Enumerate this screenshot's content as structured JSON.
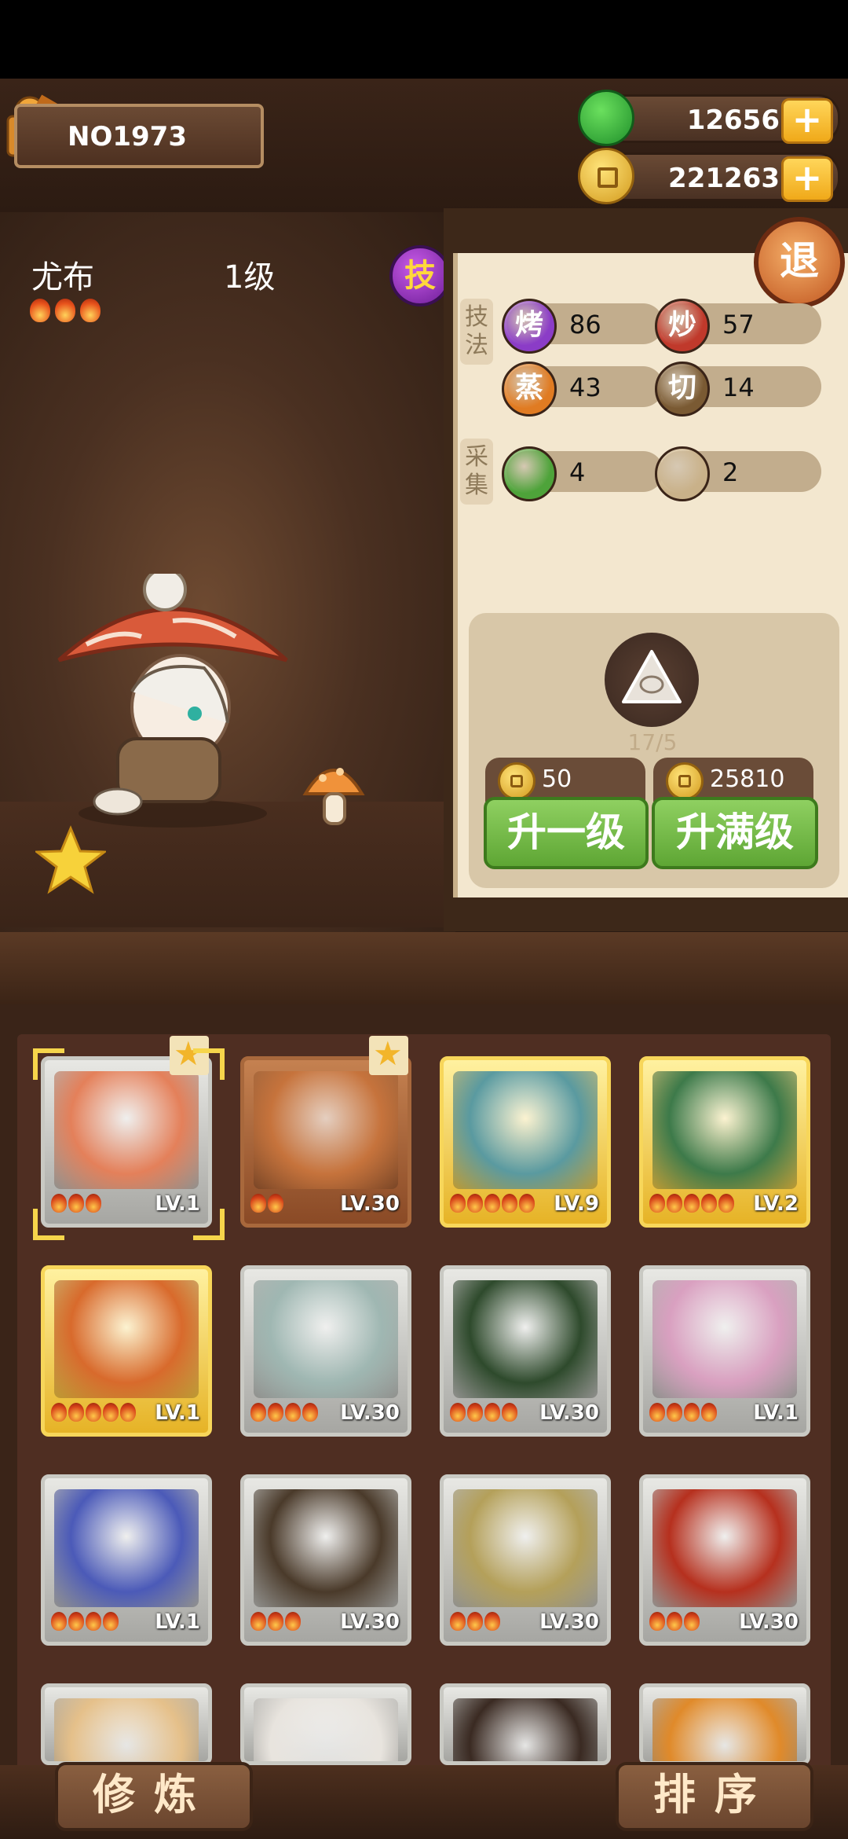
{
  "player": {
    "id": "NO1973"
  },
  "currency": {
    "jade": "12656",
    "coins": "221263"
  },
  "hero": {
    "name": "尤布",
    "level": "1级",
    "skill_badge": "技",
    "flames": 3
  },
  "panel": {
    "exit_label": "退",
    "technique_label": "技法",
    "gather_label": "采集",
    "stats": [
      {
        "icon": "烤",
        "value": "86",
        "color": "#8b3cc7"
      },
      {
        "icon": "炒",
        "value": "57",
        "color": "#c0392b"
      },
      {
        "icon": "蒸",
        "value": "43",
        "color": "#e07b22"
      },
      {
        "icon": "切",
        "value": "14",
        "color": "#7a5a33"
      },
      {
        "icon": "cabbage-icon",
        "value": "4",
        "color": "#4ea33a"
      },
      {
        "icon": "bun-icon",
        "value": "2",
        "color": "#c9b189"
      }
    ],
    "material_count": "17/5",
    "upgrade_one": {
      "cost": "50",
      "label": "升一级"
    },
    "upgrade_max": {
      "cost": "25810",
      "label": "升满级"
    }
  },
  "roster": [
    {
      "level": "LV.1",
      "flames": 3,
      "frame": "silver",
      "favorite": true,
      "selected": true,
      "color": "#e4805a"
    },
    {
      "level": "LV.30",
      "flames": 2,
      "frame": "brown",
      "favorite": true,
      "selected": false,
      "color": "#c6733c"
    },
    {
      "level": "LV.9",
      "flames": 5,
      "frame": "gold",
      "favorite": false,
      "selected": false,
      "color": "#5a9aa0"
    },
    {
      "level": "LV.2",
      "flames": 5,
      "frame": "gold",
      "favorite": false,
      "selected": false,
      "color": "#3d7a4a"
    },
    {
      "level": "LV.1",
      "flames": 5,
      "frame": "gold",
      "favorite": false,
      "selected": false,
      "color": "#d86a2c"
    },
    {
      "level": "LV.30",
      "flames": 4,
      "frame": "silver",
      "favorite": false,
      "selected": false,
      "color": "#9fb7b2"
    },
    {
      "level": "LV.30",
      "flames": 4,
      "frame": "silver",
      "favorite": false,
      "selected": false,
      "color": "#2e4a2c"
    },
    {
      "level": "LV.1",
      "flames": 4,
      "frame": "silver",
      "favorite": false,
      "selected": false,
      "color": "#d9a0c0"
    },
    {
      "level": "LV.1",
      "flames": 4,
      "frame": "silver",
      "favorite": false,
      "selected": false,
      "color": "#4b5ab8"
    },
    {
      "level": "LV.30",
      "flames": 3,
      "frame": "silver",
      "favorite": false,
      "selected": false,
      "color": "#4a3a2a"
    },
    {
      "level": "LV.30",
      "flames": 3,
      "frame": "silver",
      "favorite": false,
      "selected": false,
      "color": "#b4a05a"
    },
    {
      "level": "LV.30",
      "flames": 3,
      "frame": "silver",
      "favorite": false,
      "selected": false,
      "color": "#b6301e"
    },
    {
      "level": "",
      "flames": 0,
      "frame": "silver",
      "favorite": false,
      "selected": false,
      "color": "#e5c08a"
    },
    {
      "level": "",
      "flames": 0,
      "frame": "silver",
      "favorite": false,
      "selected": false,
      "color": "#e8e4de"
    },
    {
      "level": "",
      "flames": 0,
      "frame": "silver",
      "favorite": false,
      "selected": false,
      "color": "#3a2a22"
    },
    {
      "level": "",
      "flames": 0,
      "frame": "silver",
      "favorite": false,
      "selected": false,
      "color": "#e08a2a"
    }
  ],
  "bottom": {
    "train_label": "修炼",
    "sort_label": "排序"
  }
}
